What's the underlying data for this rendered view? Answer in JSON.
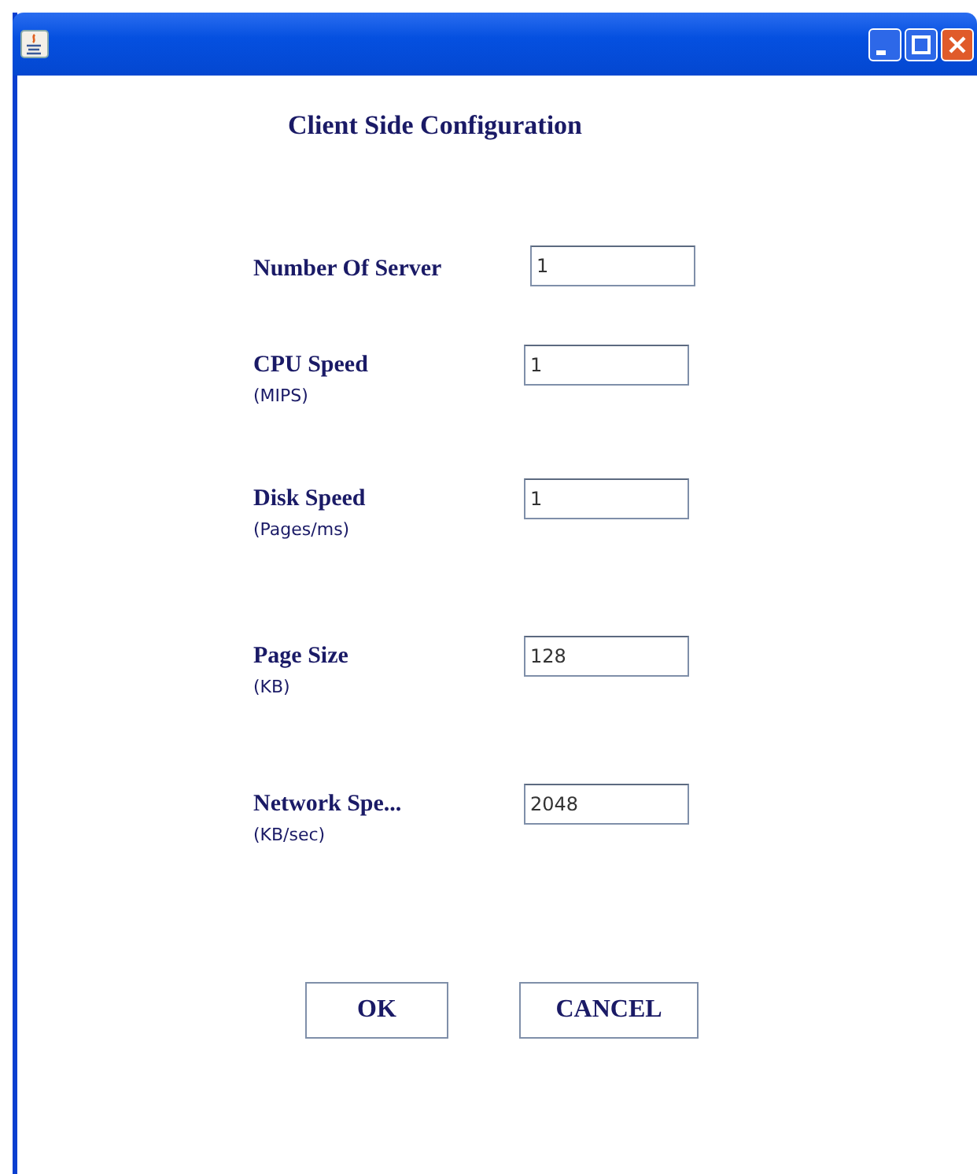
{
  "window": {
    "title_bar_buttons": [
      {
        "kind": "minimize"
      },
      {
        "kind": "maximize"
      },
      {
        "kind": "close"
      }
    ]
  },
  "heading": "Client Side Configuration",
  "fields": [
    {
      "label": "Number Of Server",
      "value": "1"
    },
    {
      "label": "CPU Speed",
      "unit": "(MIPS)",
      "value": "1"
    },
    {
      "label": "Disk Speed",
      "unit": "(Pages/ms)",
      "value": "1"
    },
    {
      "label": "Page Size",
      "unit": "(KB)",
      "value": "128"
    },
    {
      "label": "Network Spe...",
      "unit": "(KB/sec)",
      "value": "2048"
    }
  ],
  "buttons": [
    "OK",
    "CANCEL"
  ]
}
